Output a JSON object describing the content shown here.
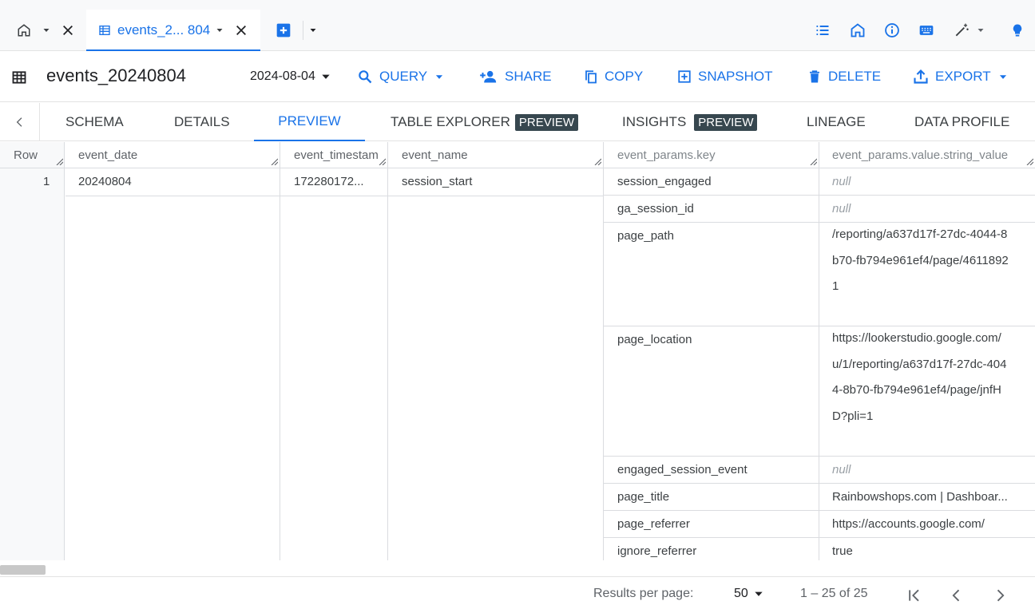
{
  "tabs": {
    "active_label": "events_2... 804"
  },
  "toolbar": {
    "title": "events_20240804",
    "date_value": "2024-08-04",
    "query_label": "QUERY",
    "share_label": "SHARE",
    "copy_label": "COPY",
    "snapshot_label": "SNAPSHOT",
    "delete_label": "DELETE",
    "export_label": "EXPORT"
  },
  "subtabs": {
    "schema": "SCHEMA",
    "details": "DETAILS",
    "preview": "PREVIEW",
    "table_explorer": "TABLE EXPLORER",
    "table_explorer_badge": "PREVIEW",
    "insights": "INSIGHTS",
    "insights_badge": "PREVIEW",
    "lineage": "LINEAGE",
    "data_profile": "DATA PROFILE"
  },
  "grid": {
    "columns": [
      "Row",
      "event_date",
      "event_timestam",
      "event_name",
      "event_params.key",
      "event_params.value.string_value"
    ],
    "row": {
      "num": "1",
      "event_date": "20240804",
      "event_timestamp": "172280172...",
      "event_name": "session_start"
    },
    "params": [
      {
        "key": "session_engaged",
        "value": "null"
      },
      {
        "key": "ga_session_id",
        "value": "null"
      },
      {
        "key": "page_path",
        "value": "/reporting/a637d17f-27dc-4044-8b70-fb794e961ef4/page/46118921"
      },
      {
        "key": "page_location",
        "value": "https://lookerstudio.google.com/u/1/reporting/a637d17f-27dc-4044-8b70-fb794e961ef4/page/jnfHD?pli=1"
      },
      {
        "key": "engaged_session_event",
        "value": "null"
      },
      {
        "key": "page_title",
        "value": "Rainbowshops.com | Dashboar..."
      },
      {
        "key": "page_referrer",
        "value": "https://accounts.google.com/"
      },
      {
        "key": "ignore_referrer",
        "value": "true"
      }
    ]
  },
  "footer": {
    "results_per_page_label": "Results per page:",
    "per_page_value": "50",
    "range": "1 – 25 of 25"
  },
  "colors": {
    "accent": "#1a73e8",
    "badge_bg": "#37474f"
  }
}
